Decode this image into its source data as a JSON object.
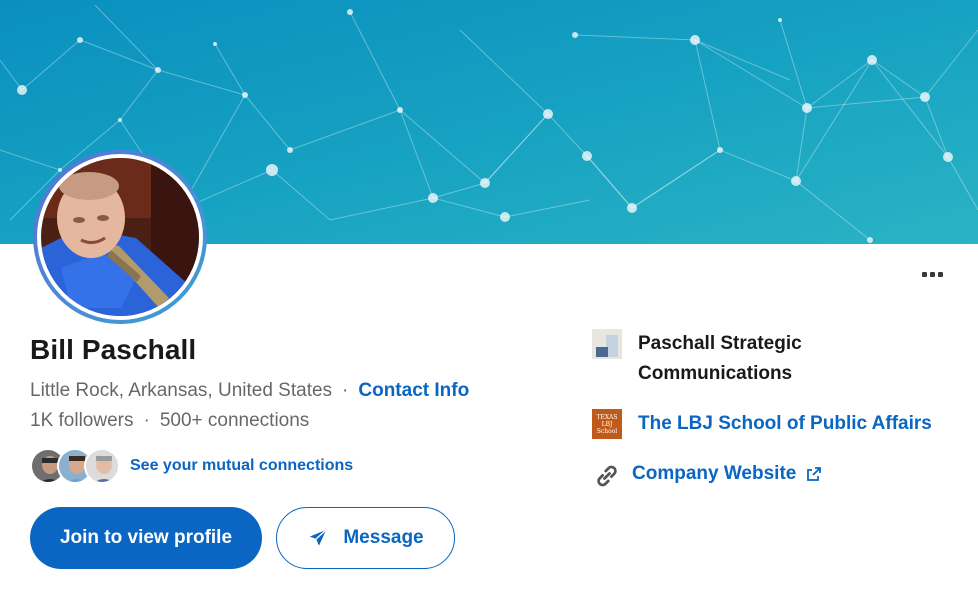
{
  "colors": {
    "brand_blue": "#0a66c2",
    "banner_start": "#0a8fbf",
    "banner_end": "#2bb3c4",
    "text_primary": "rgba(0,0,0,0.9)",
    "text_secondary": "rgba(0,0,0,0.6)",
    "school_logo_bg": "#bf5a1b"
  },
  "header": {
    "more_icon": "ellipsis-icon"
  },
  "profile": {
    "name": "Bill Paschall",
    "location": "Little Rock, Arkansas, United States",
    "separator": "·",
    "contact_info_label": "Contact Info",
    "followers": "1K followers",
    "connections": "500+ connections",
    "mutual_label": "See your mutual connections"
  },
  "actions": {
    "join_label": "Join to view profile",
    "message_label": "Message",
    "message_icon": "send-icon"
  },
  "sidebar": {
    "company": "Paschall Strategic Communications",
    "school": "The LBJ School of Public Affairs",
    "school_logo_lines": [
      "TEXAS",
      "LBJ School"
    ],
    "website_label": "Company Website",
    "website_icon": "link-icon",
    "external_icon": "external-link-icon"
  }
}
